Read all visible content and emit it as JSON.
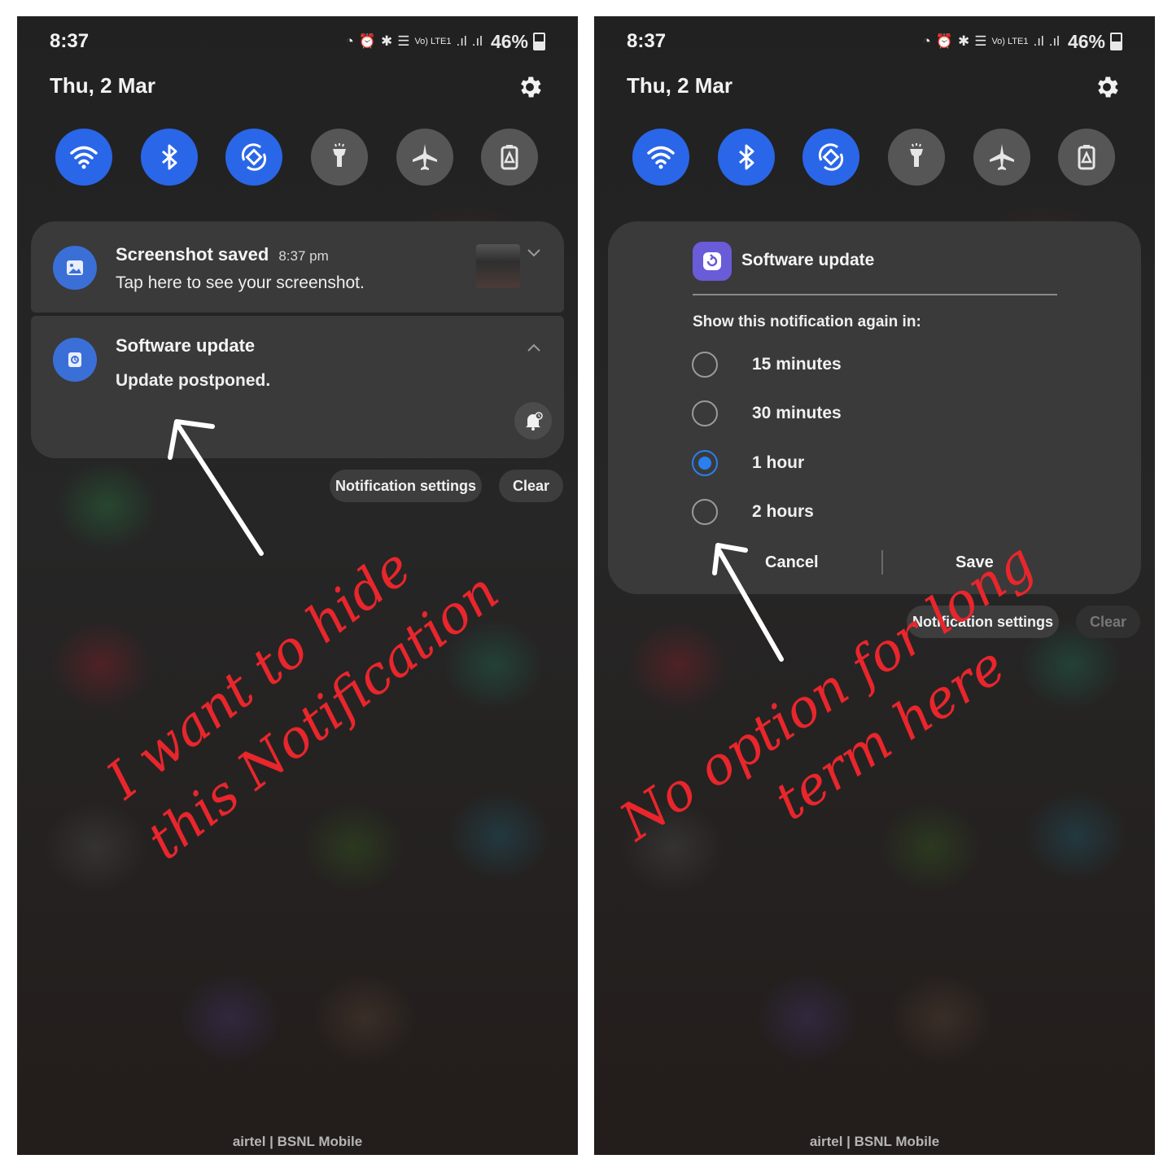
{
  "left": {
    "status": {
      "time": "8:37",
      "signal": "Vo) LTE1",
      "battery": "46%"
    },
    "date": "Thu, 2 Mar",
    "quick_settings": [
      {
        "name": "wifi",
        "state": "on"
      },
      {
        "name": "bluetooth",
        "state": "on"
      },
      {
        "name": "auto-rotate",
        "state": "on"
      },
      {
        "name": "flashlight",
        "state": "off"
      },
      {
        "name": "airplane-mode",
        "state": "off"
      },
      {
        "name": "power-saving",
        "state": "off"
      }
    ],
    "notifications": [
      {
        "title": "Screenshot saved",
        "time": "8:37 pm",
        "text": "Tap here to see your screenshot.",
        "icon": "image-icon"
      },
      {
        "title": "Software update",
        "text": "Update postponed.",
        "icon": "software-update-icon"
      }
    ],
    "actions": {
      "settings": "Notification settings",
      "clear": "Clear"
    },
    "carrier": "airtel | BSNL Mobile",
    "annotation": {
      "line1": "I want to hide",
      "line2": "this Notification"
    }
  },
  "right": {
    "status": {
      "time": "8:37",
      "signal": "Vo) LTE1",
      "battery": "46%"
    },
    "date": "Thu, 2 Mar",
    "dialog": {
      "app": "Software update",
      "prompt": "Show this notification again in:",
      "options": [
        {
          "label": "15 minutes",
          "checked": false
        },
        {
          "label": "30 minutes",
          "checked": false
        },
        {
          "label": "1 hour",
          "checked": true
        },
        {
          "label": "2 hours",
          "checked": false
        }
      ],
      "cancel": "Cancel",
      "save": "Save"
    },
    "actions": {
      "settings": "Notification settings",
      "clear": "Clear"
    },
    "carrier": "airtel | BSNL Mobile",
    "annotation": {
      "line1": "No option for long",
      "line2": "term here"
    }
  },
  "colors": {
    "accent": "#2a66e8",
    "annotation": "#e8262c",
    "card": "#3a3a3a"
  }
}
